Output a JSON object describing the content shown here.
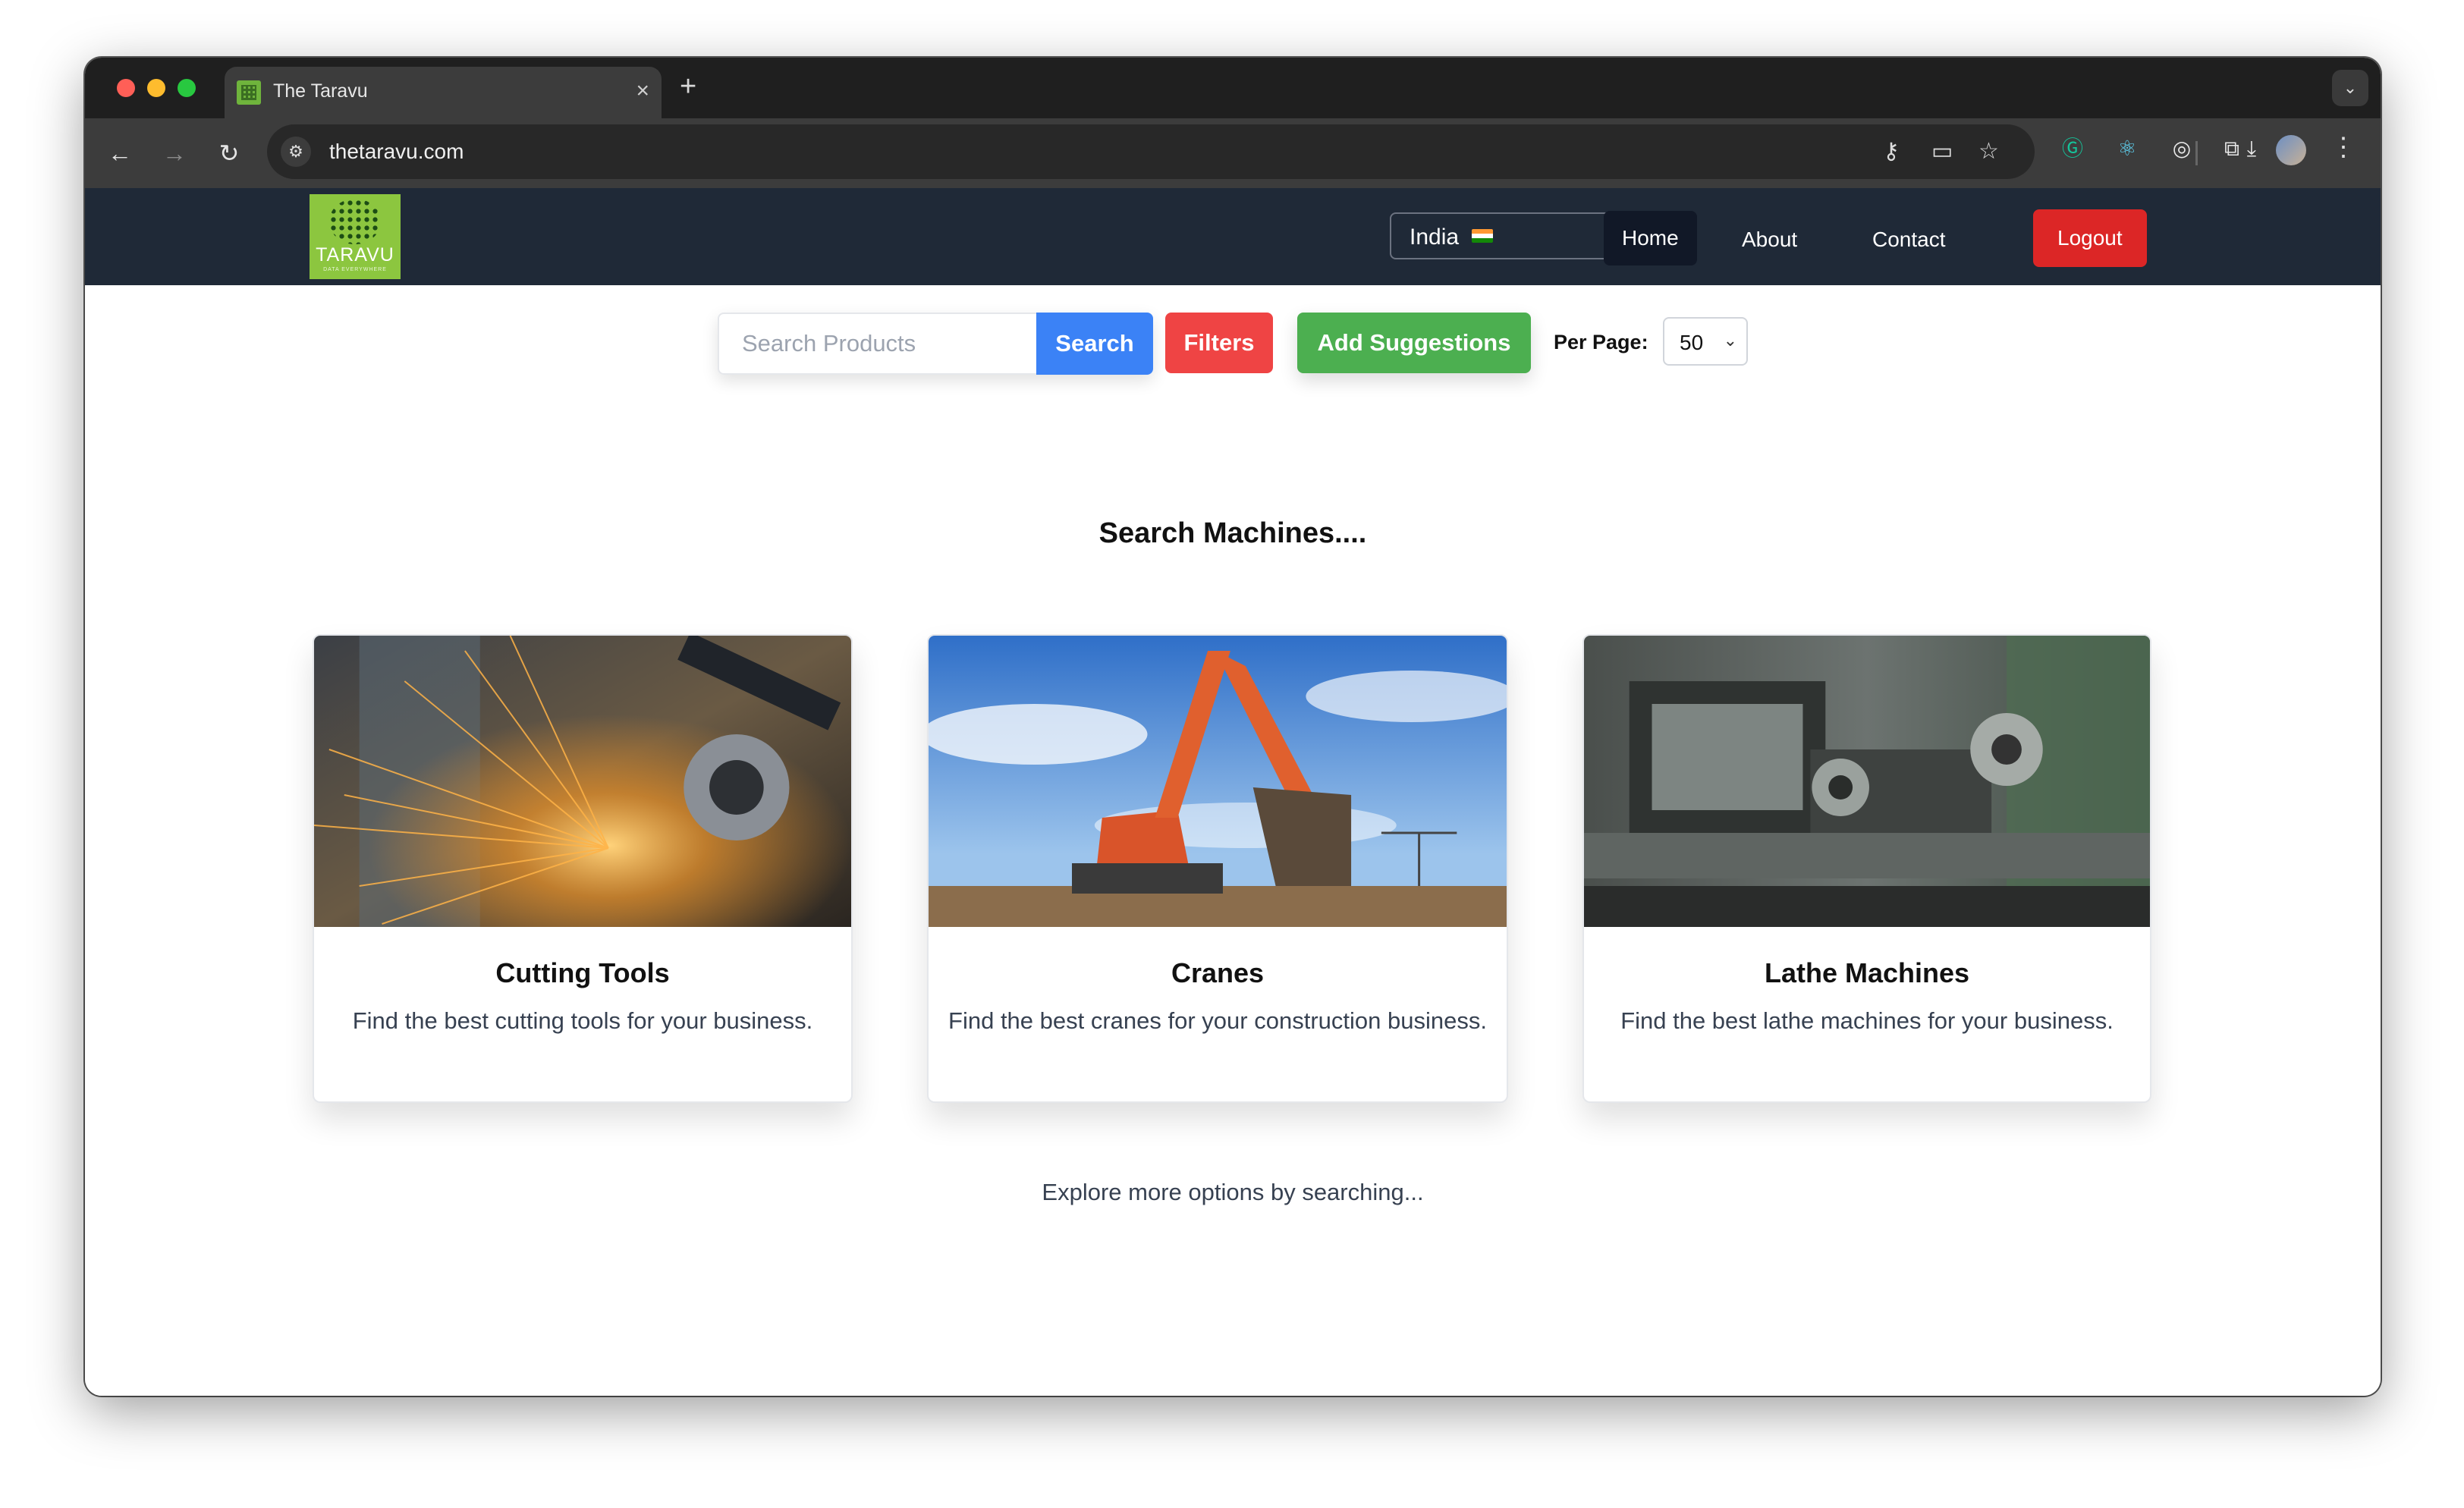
{
  "browser": {
    "tab_title": "The Taravu",
    "tab_close": "×",
    "new_tab": "+",
    "url": "thetaravu.com",
    "icons": [
      "back-icon",
      "forward-icon",
      "reload-icon",
      "site-settings-icon",
      "password-key-icon",
      "cast-icon",
      "bookmark-star-icon",
      "grammarly-icon",
      "react-devtools-icon",
      "extension-target-icon",
      "extensions-puzzle-icon",
      "download-icon",
      "profile-avatar",
      "more-menu-icon"
    ]
  },
  "site": {
    "logo_text": "TARAVU",
    "logo_tagline": "DATA EVERYWHERE",
    "country_selected": "India",
    "nav": {
      "home": "Home",
      "about": "About",
      "contact": "Contact",
      "logout": "Logout"
    },
    "colors": {
      "nav_bg": "#1f2937",
      "search_button": "#3b82f6",
      "filters_button": "#ef4444",
      "suggestions_button": "#4caf50",
      "logout_button": "#dc2626",
      "logo_bg": "#8cc63f"
    }
  },
  "search": {
    "placeholder": "Search Products",
    "value": "",
    "search_label": "Search",
    "filters_label": "Filters",
    "suggestions_label": "Add Suggestions",
    "per_page_label": "Per Page:",
    "per_page_value": "50"
  },
  "main": {
    "heading": "Search Machines....",
    "cards": [
      {
        "title": "Cutting Tools",
        "description": "Find the best cutting tools for your business."
      },
      {
        "title": "Cranes",
        "description": "Find the best cranes for your construction business."
      },
      {
        "title": "Lathe Machines",
        "description": "Find the best lathe machines for your business."
      }
    ],
    "explore_text": "Explore more options by searching..."
  }
}
